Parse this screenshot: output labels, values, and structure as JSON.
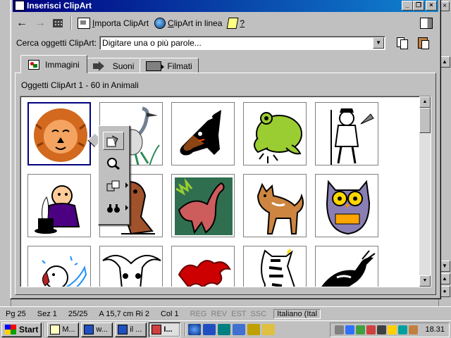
{
  "dialog": {
    "title": "Inserisci ClipArt"
  },
  "toolbar": {
    "back": "back-arrow",
    "forward": "forward-arrow",
    "import_label_pre": "",
    "import_label_u": "I",
    "import_label_post": "mporta ClipArt",
    "online_label_u": "C",
    "online_label_post": "lipArt in linea",
    "help_label": "?"
  },
  "search": {
    "label": "Cerca oggetti ClipArt:",
    "value": "Digitare una o più parole..."
  },
  "tabs": [
    {
      "label": "Immagini",
      "u": "I",
      "active": true
    },
    {
      "label": "Suoni",
      "u": "S",
      "active": false
    },
    {
      "label": "Filmati",
      "u": "F",
      "active": false
    }
  ],
  "panel": {
    "caption": "Oggetti ClipArt 1 - 60 in Animali"
  },
  "gallery": {
    "items": [
      {
        "name": "lion"
      },
      {
        "name": "heron"
      },
      {
        "name": "horse"
      },
      {
        "name": "frog"
      },
      {
        "name": "farmer"
      },
      {
        "name": "magician"
      },
      {
        "name": "dog"
      },
      {
        "name": "dinosaur"
      },
      {
        "name": "akita"
      },
      {
        "name": "owl"
      },
      {
        "name": "puppy"
      },
      {
        "name": "cattle-skull"
      },
      {
        "name": "dragon"
      },
      {
        "name": "zebra"
      },
      {
        "name": "antelope"
      }
    ]
  },
  "statusbar": {
    "page": "Pg 25",
    "section": "Sez 1",
    "pages": "25/25",
    "position": "A 15,7 cm Ri 2",
    "column": "Col 1",
    "reg": "REG",
    "rev": "REV",
    "est": "EST",
    "ssc": "SSC",
    "language": "Italiano (Ital"
  },
  "taskbar": {
    "start": "Start",
    "tasks": [
      "M...",
      "w...",
      "il ...",
      "I..."
    ],
    "clock": "18.31"
  },
  "colors": {
    "titlebar_start": "#000080",
    "titlebar_end": "#1084d0",
    "face": "#c0c0c0"
  }
}
